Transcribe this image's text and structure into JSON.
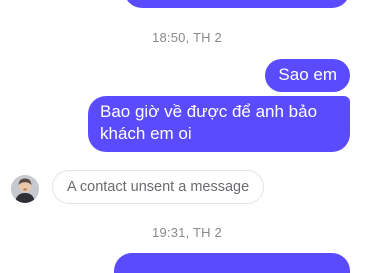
{
  "conversation": {
    "timestamps": [
      "18:50, TH 2",
      "19:31, TH 2"
    ],
    "messages": {
      "sao_em": "Sao em",
      "bao_gio": "Bao giờ về được để anh bảo khách em oi"
    },
    "unsent_notice": "A contact unsent a message",
    "avatar_icon": "contact-avatar-icon"
  },
  "colors": {
    "outgoing_bubble": "#5a4bff",
    "timestamp_text": "#8a8a8e",
    "notice_border": "#e3e4e8"
  }
}
